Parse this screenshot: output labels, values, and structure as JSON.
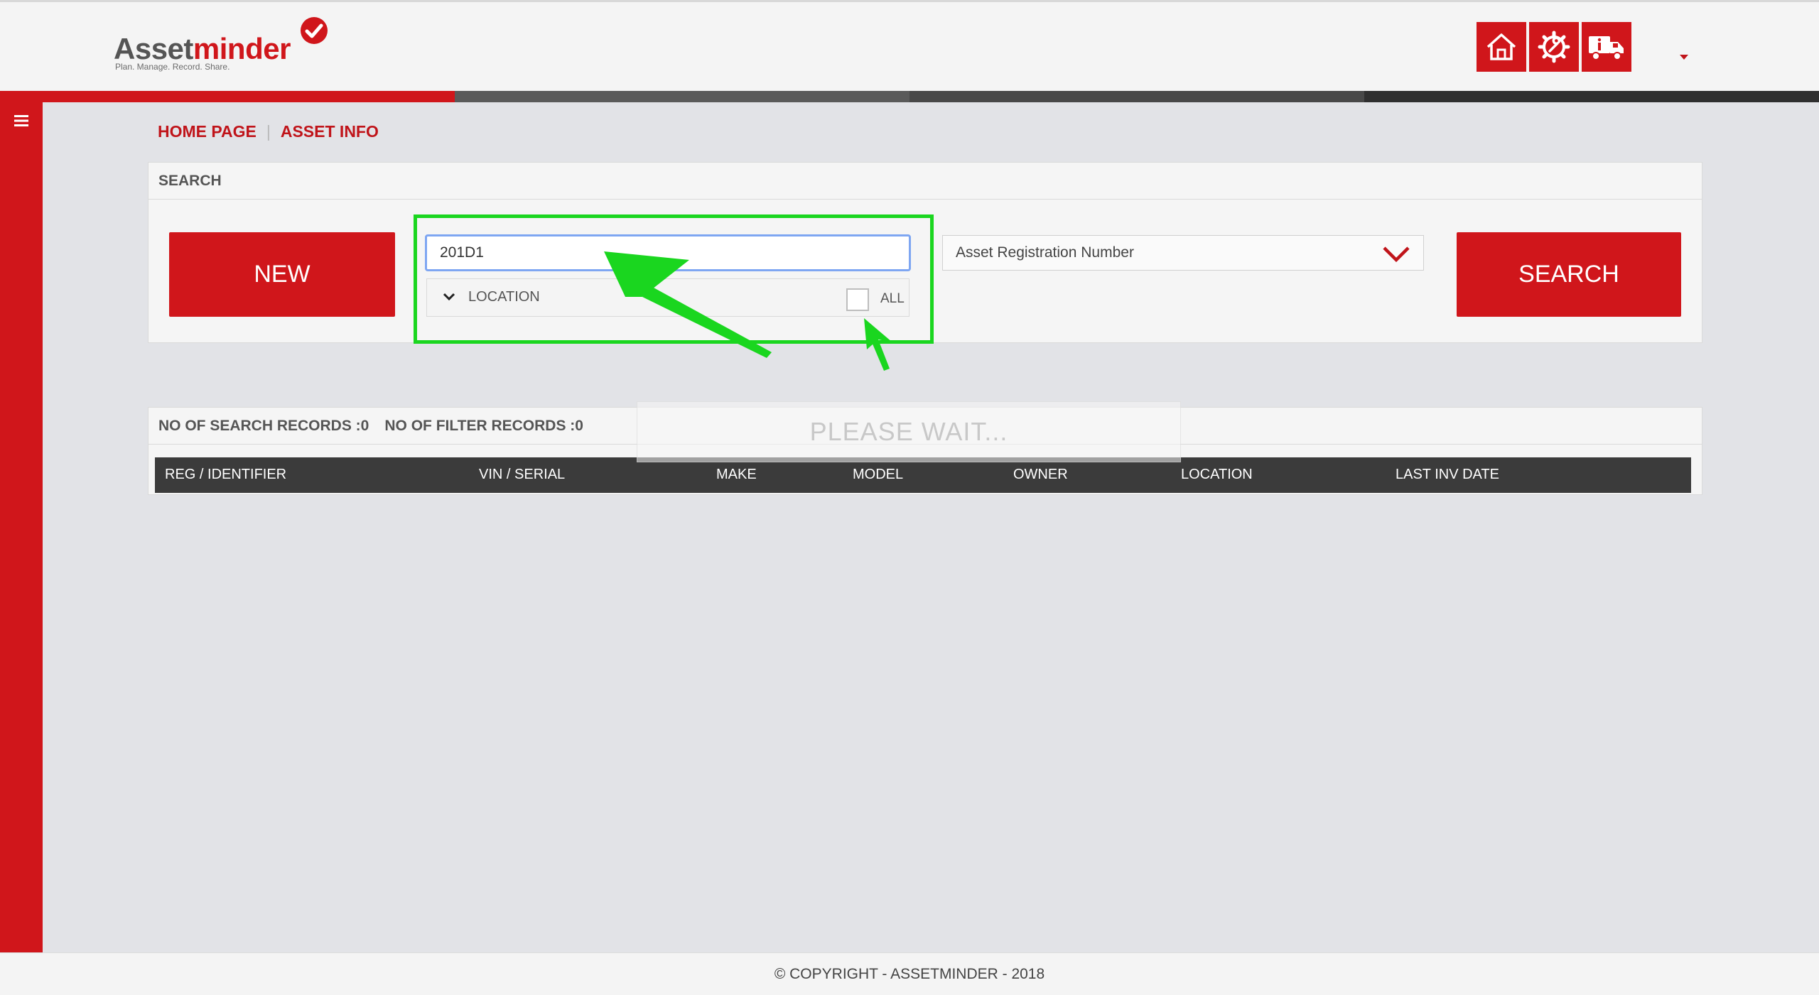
{
  "header": {
    "logo": {
      "brand_a": "Asset",
      "brand_b": "minder",
      "tagline": "Plan. Manage. Record. Share."
    },
    "icons": [
      "home-icon",
      "gear-wrench-icon",
      "truck-info-icon"
    ],
    "accent_color": "#d0161b"
  },
  "breadcrumb": {
    "home": "HOME PAGE",
    "separator": "|",
    "current": "ASSET INFO"
  },
  "search": {
    "panel_title": "SEARCH",
    "new_button": "NEW",
    "input_value": "201D1",
    "location_label": "LOCATION",
    "all_label": "ALL",
    "all_checked": false,
    "field_select": "Asset Registration Number",
    "search_button": "SEARCH"
  },
  "results": {
    "search_records": "NO OF SEARCH RECORDS :0",
    "filter_records": "NO OF FILTER RECORDS :0",
    "columns": [
      "REG / IDENTIFIER",
      "VIN / SERIAL",
      "MAKE",
      "MODEL",
      "OWNER",
      "LOCATION",
      "LAST INV DATE"
    ]
  },
  "overlay": {
    "wait_text": "PLEASE WAIT..."
  },
  "annotation": {
    "highlight_color": "#1ad61f"
  },
  "footer": {
    "copyright": "© COPYRIGHT - ASSETMINDER - 2018"
  }
}
